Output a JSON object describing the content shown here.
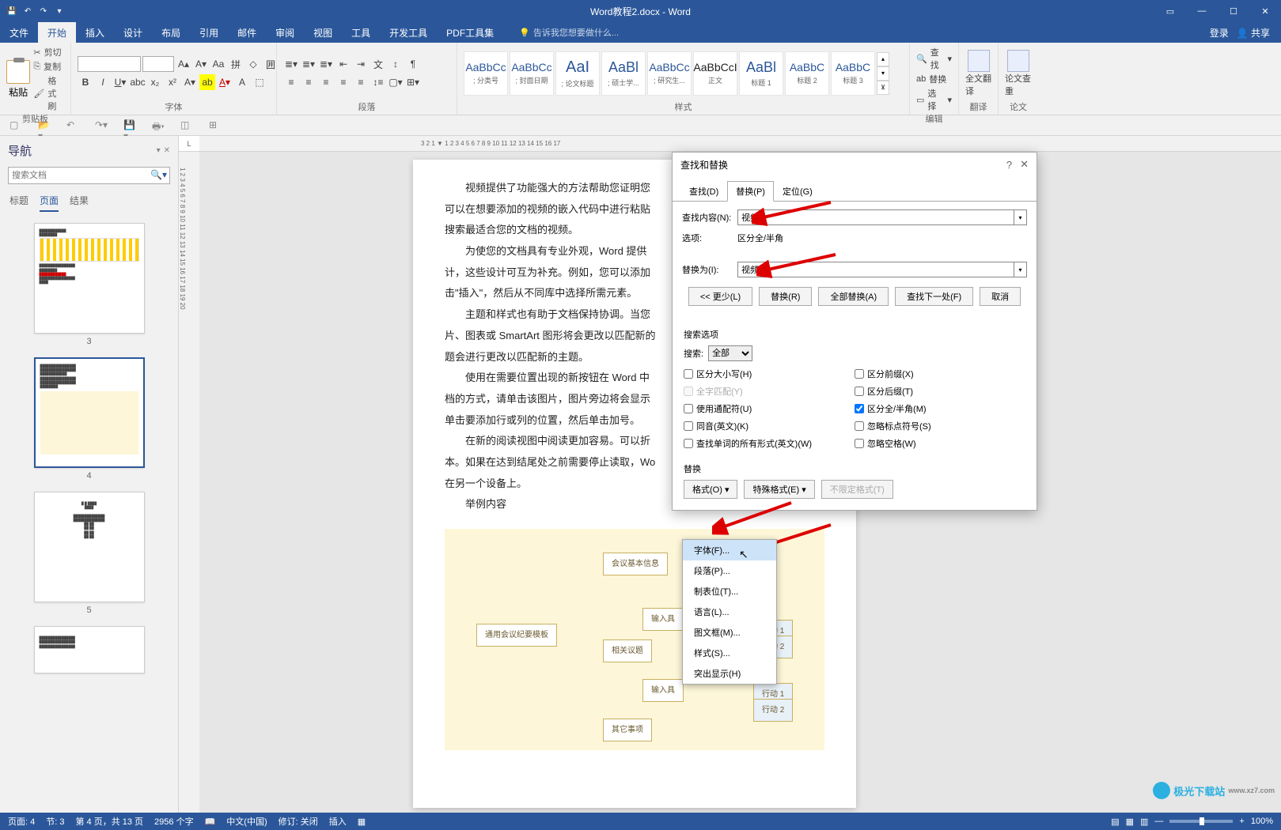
{
  "title": "Word教程2.docx - Word",
  "menubar": {
    "tabs": [
      "文件",
      "开始",
      "插入",
      "设计",
      "布局",
      "引用",
      "邮件",
      "审阅",
      "视图",
      "工具",
      "开发工具",
      "PDF工具集"
    ],
    "tell_me": "告诉我您想要做什么...",
    "login": "登录",
    "share": "共享"
  },
  "ribbon": {
    "clipboard": {
      "paste": "粘贴",
      "cut": "剪切",
      "copy": "复制",
      "painter": "格式刷",
      "label": "剪贴板"
    },
    "font": {
      "label": "字体"
    },
    "paragraph": {
      "label": "段落"
    },
    "styles": {
      "label": "样式",
      "items": [
        {
          "preview": "AaBbCc",
          "name": "; 分类号"
        },
        {
          "preview": "AaBbCc",
          "name": "; 封面日期"
        },
        {
          "preview": "AaI",
          "name": "; 论文标题"
        },
        {
          "preview": "AaBl",
          "name": "; 硕士学..."
        },
        {
          "preview": "AaBbCc",
          "name": "; 研究生..."
        },
        {
          "preview": "AaBbCcI",
          "name": "正文"
        },
        {
          "preview": "AaBl",
          "name": "标题 1"
        },
        {
          "preview": "AaBbC",
          "name": "标题 2"
        },
        {
          "preview": "AaBbC",
          "name": "标题 3"
        }
      ]
    },
    "edit": {
      "label": "编辑",
      "find": "查找",
      "replace": "替换",
      "select": "选择"
    },
    "translate": {
      "label": "翻译",
      "btn": "全文翻译"
    },
    "thesis": {
      "label": "论文",
      "btn": "论文查重"
    }
  },
  "nav": {
    "title": "导航",
    "search_placeholder": "搜索文档",
    "tabs": [
      "标题",
      "页面",
      "结果"
    ],
    "pages": [
      "3",
      "4",
      "5"
    ]
  },
  "document": {
    "paragraphs": [
      "视频提供了功能强大的方法帮助您证明您",
      "可以在想要添加的视频的嵌入代码中进行粘贴",
      "搜索最适合您的文档的视频。",
      "为使您的文档具有专业外观，Word 提供",
      "计，这些设计可互为补充。例如，您可以添加",
      "击\"插入\"，然后从不同库中选择所需元素。",
      "主题和样式也有助于文档保持协调。当您",
      "片、图表或 SmartArt 图形将会更改以匹配新的",
      "题会进行更改以匹配新的主题。",
      "使用在需要位置出现的新按钮在 Word 中",
      "档的方式，请单击该图片，图片旁边将会显示",
      "单击要添加行或列的位置，然后单击加号。",
      "在新的阅读视图中阅读更加容易。可以折",
      "本。如果在达到结尾处之前需要停止读取，Wo",
      "在另一个设备上。",
      "举例内容"
    ],
    "diagram": {
      "center": "通用会议纪要模板",
      "nodes": [
        "会议基本信息",
        "输入具",
        "相关议题",
        "输入具",
        "其它事项"
      ],
      "leaves": [
        "行动 1",
        "行动 2",
        "行动 1",
        "行动 2"
      ]
    }
  },
  "dialog": {
    "title": "查找和替换",
    "tabs": [
      "查找(D)",
      "替换(P)",
      "定位(G)"
    ],
    "find_label": "查找内容(N):",
    "find_value": "视频",
    "options_label": "选项:",
    "options_value": "区分全/半角",
    "replace_label": "替换为(I):",
    "replace_value": "视频",
    "buttons": {
      "less": "<< 更少(L)",
      "replace": "替换(R)",
      "replace_all": "全部替换(A)",
      "find_next": "查找下一处(F)",
      "cancel": "取消"
    },
    "search_options_title": "搜索选项",
    "search_label": "搜索:",
    "search_value": "全部",
    "checks_left": [
      "区分大小写(H)",
      "全字匹配(Y)",
      "使用通配符(U)",
      "同音(英文)(K)",
      "查找单词的所有形式(英文)(W)"
    ],
    "checks_right": [
      "区分前缀(X)",
      "区分后缀(T)",
      "区分全/半角(M)",
      "忽略标点符号(S)",
      "忽略空格(W)"
    ],
    "replace_section": "替换",
    "format_btn": "格式(O)",
    "special_btn": "特殊格式(E)",
    "noformat_btn": "不限定格式(T)"
  },
  "format_menu": [
    "字体(F)...",
    "段落(P)...",
    "制表位(T)...",
    "语言(L)...",
    "图文框(M)...",
    "样式(S)...",
    "突出显示(H)"
  ],
  "statusbar": {
    "page": "页面: 4",
    "section": "节: 3",
    "page_of": "第 4 页，共 13 页",
    "words": "2956 个字",
    "lang": "中文(中国)",
    "revise": "修订: 关闭",
    "insert": "插入",
    "zoom": "100%"
  },
  "watermark": "极光下载站"
}
